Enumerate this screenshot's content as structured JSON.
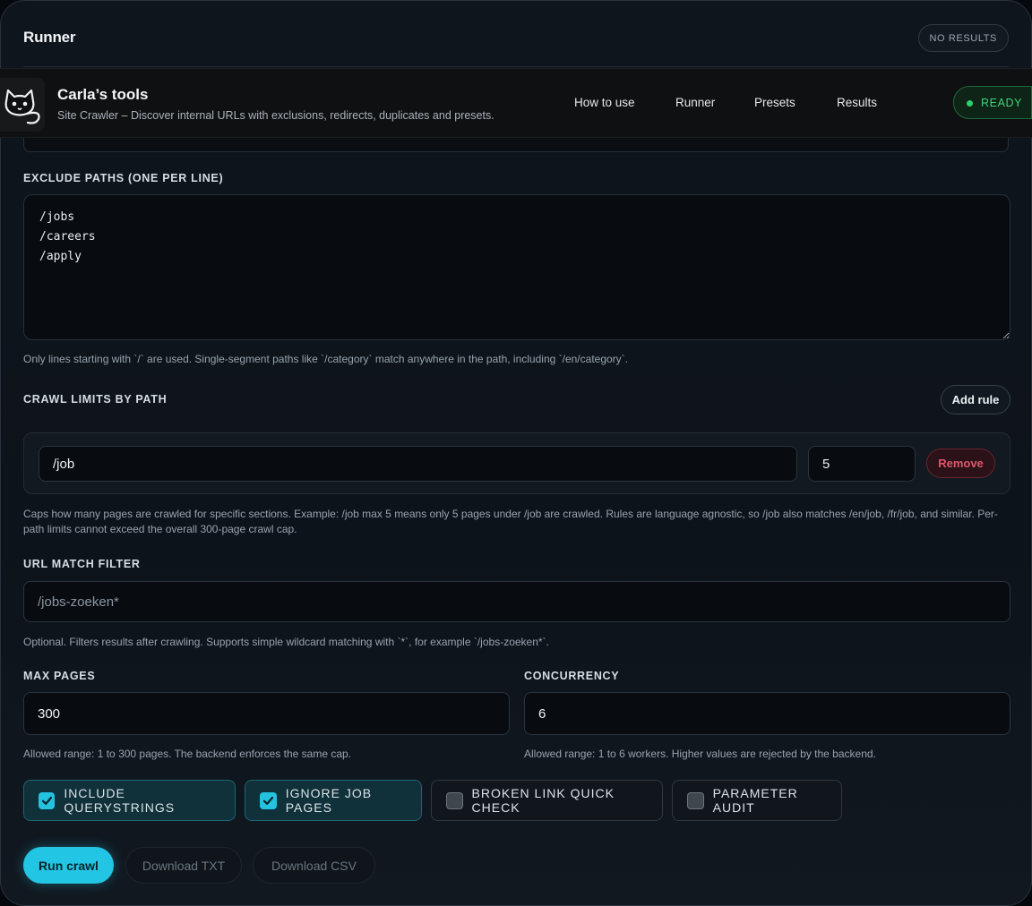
{
  "runner": {
    "title": "Runner",
    "status": "NO RESULTS"
  },
  "appbar": {
    "name": "Carla’s tools",
    "subtitle": "Site Crawler – Discover internal URLs with exclusions, redirects, duplicates and presets.",
    "nav": [
      "How to use",
      "Runner",
      "Presets",
      "Results"
    ],
    "state": "READY"
  },
  "exclude": {
    "label": "EXCLUDE PATHS (ONE PER LINE)",
    "value": "/jobs\n/careers\n/apply",
    "help": "Only lines starting with `/` are used. Single-segment paths like `/category` match anywhere in the path, including `/en/category`."
  },
  "limits": {
    "label": "CRAWL LIMITS BY PATH",
    "add_label": "Add rule",
    "rule": {
      "path": "/job",
      "max": "5",
      "remove_label": "Remove"
    },
    "help": "Caps how many pages are crawled for specific sections. Example: /job max 5 means only 5 pages under /job are crawled. Rules are language agnostic, so /job also matches /en/job, /fr/job, and similar. Per-path limits cannot exceed the overall 300-page crawl cap."
  },
  "filter": {
    "label": "URL MATCH FILTER",
    "placeholder": "/jobs-zoeken*",
    "help": "Optional. Filters results after crawling. Supports simple wildcard matching with `*`, for example `/jobs-zoeken*`."
  },
  "max_pages": {
    "label": "MAX PAGES",
    "value": "300",
    "help": "Allowed range: 1 to 300 pages. The backend enforces the same cap."
  },
  "concurrency": {
    "label": "CONCURRENCY",
    "value": "6",
    "help": "Allowed range: 1 to 6 workers. Higher values are rejected by the backend."
  },
  "options": [
    {
      "label": "INCLUDE QUERYSTRINGS",
      "checked": true
    },
    {
      "label": "IGNORE JOB PAGES",
      "checked": true
    },
    {
      "label": "BROKEN LINK QUICK CHECK",
      "checked": false
    },
    {
      "label": "PARAMETER AUDIT",
      "checked": false
    }
  ],
  "actions": {
    "run": "Run crawl",
    "download_txt": "Download TXT",
    "download_csv": "Download CSV"
  },
  "colors": {
    "accent": "#22c5e3",
    "ready": "#41d37a",
    "danger": "#e0566c"
  }
}
